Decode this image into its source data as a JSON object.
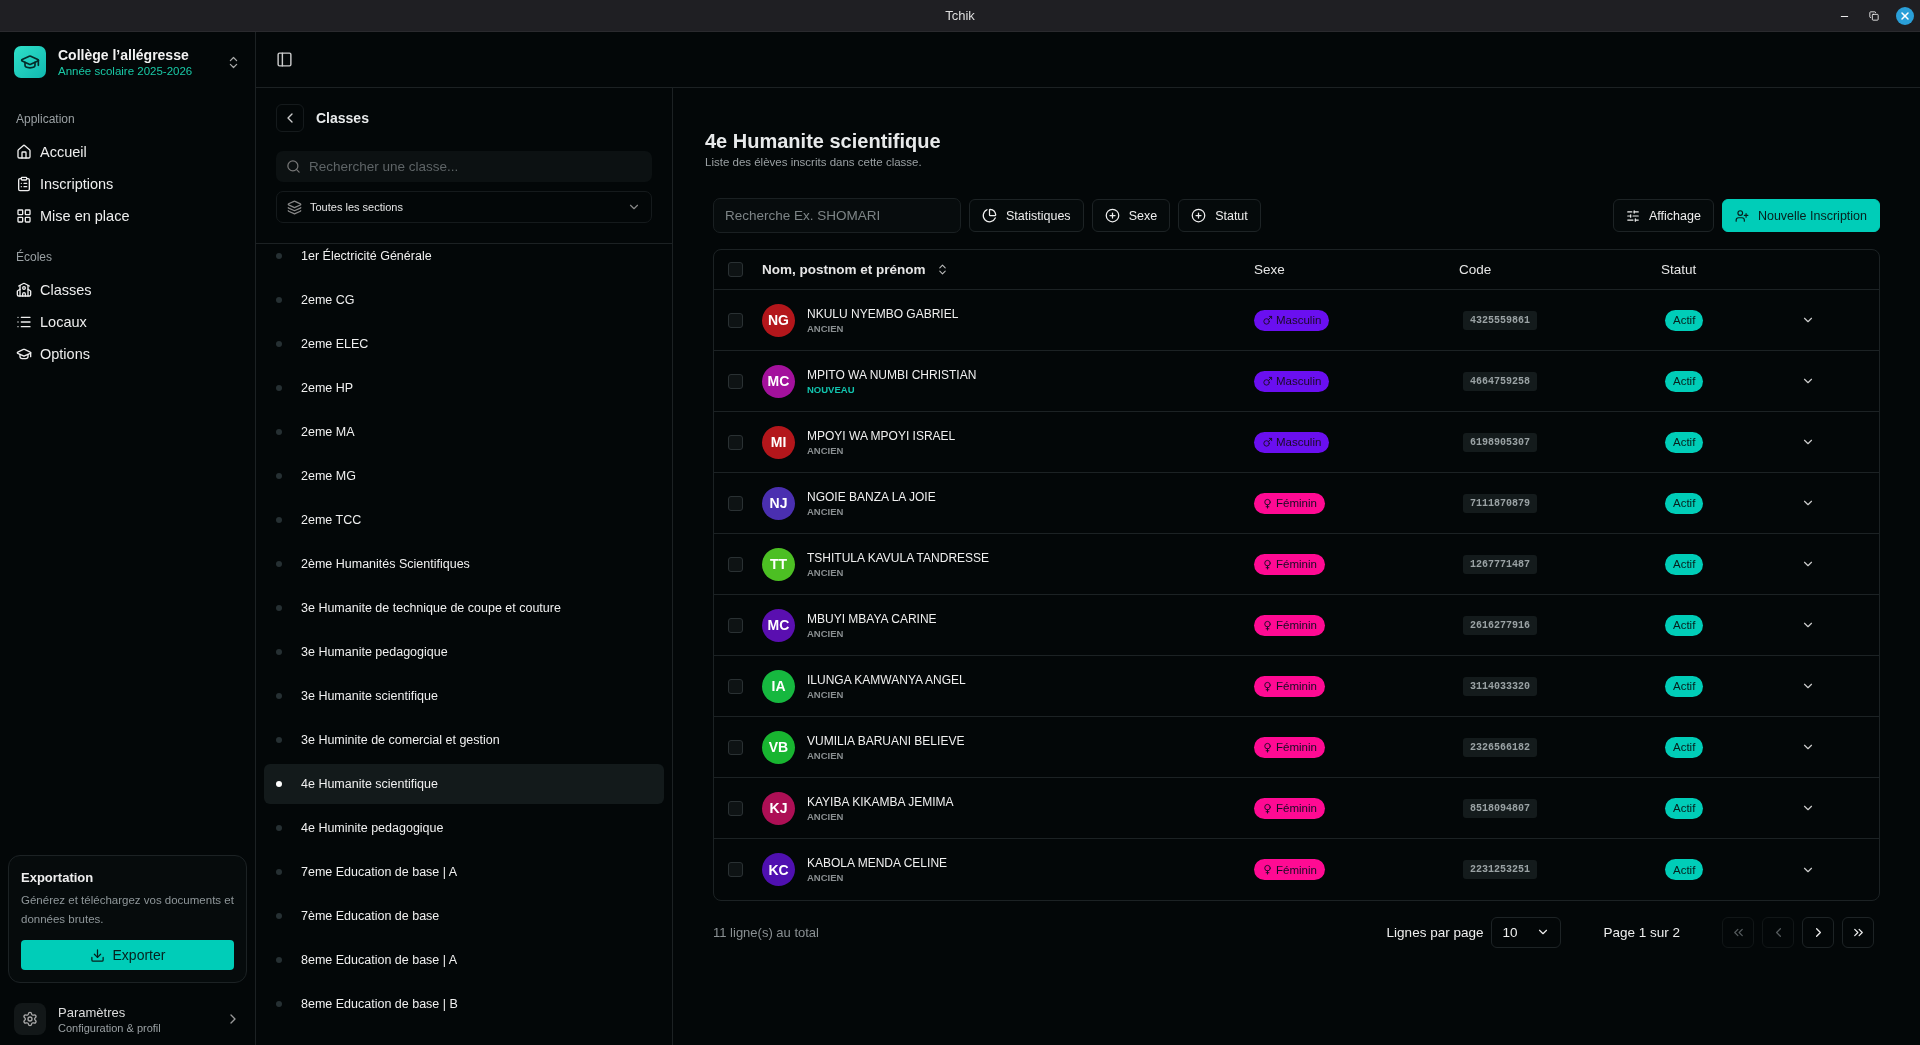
{
  "window": {
    "title": "Tchik"
  },
  "sidebar": {
    "school": {
      "name": "Collège l’allégresse",
      "year": "Année scolaire 2025-2026"
    },
    "groups": [
      {
        "label": "Application",
        "items": [
          {
            "kind": "home",
            "label": "Accueil",
            "selected": false
          },
          {
            "kind": "clipboard",
            "label": "Inscriptions",
            "selected": false
          },
          {
            "kind": "grid",
            "label": "Mise en place",
            "selected": false
          }
        ]
      },
      {
        "label": "Écoles",
        "items": [
          {
            "kind": "school",
            "label": "Classes",
            "selected": false
          },
          {
            "kind": "list",
            "label": "Locaux",
            "selected": false
          },
          {
            "kind": "cap",
            "label": "Options",
            "selected": false
          }
        ]
      }
    ],
    "export_card": {
      "title": "Exportation",
      "text": "Générez et téléchargez vos documents et données brutes.",
      "button": "Exporter"
    },
    "settings": {
      "title": "Paramètres",
      "subtitle": "Configuration & profil"
    }
  },
  "classes_panel": {
    "title": "Classes",
    "search": {
      "placeholder": "Rechercher une classe..."
    },
    "section_filter": "Toutes les sections",
    "items": [
      {
        "label": "1er Électricité Générale",
        "selected": false
      },
      {
        "label": "2eme CG",
        "selected": false
      },
      {
        "label": "2eme ELEC",
        "selected": false
      },
      {
        "label": "2eme HP",
        "selected": false
      },
      {
        "label": "2eme MA",
        "selected": false
      },
      {
        "label": "2eme MG",
        "selected": false
      },
      {
        "label": "2eme TCC",
        "selected": false
      },
      {
        "label": "2ème Humanités Scientifiques",
        "selected": false
      },
      {
        "label": "3e Humanite de technique de coupe et couture",
        "selected": false
      },
      {
        "label": "3e Humanite pedagogique",
        "selected": false
      },
      {
        "label": "3e Humanite scientifique",
        "selected": false
      },
      {
        "label": "3e Huminite de comercial et gestion",
        "selected": false
      },
      {
        "label": "4e Humanite scientifique",
        "selected": true
      },
      {
        "label": "4e Huminite pedagogique",
        "selected": false
      },
      {
        "label": "7eme Education de base | A",
        "selected": false
      },
      {
        "label": "7ème Education de base",
        "selected": false
      },
      {
        "label": "8eme Education de base | A",
        "selected": false
      },
      {
        "label": "8eme Education de base | B",
        "selected": false
      }
    ]
  },
  "main": {
    "title": "4e Humanite scientifique",
    "subtitle": "Liste des élèves inscrits dans cette classe.",
    "toolbar": {
      "search": {
        "placeholder": "Recherche Ex. SHOMARI"
      },
      "filters": [
        {
          "kind": "chart",
          "label": "Statistiques"
        },
        {
          "kind": "add",
          "label": "Sexe"
        },
        {
          "kind": "add",
          "label": "Statut"
        }
      ],
      "view_button": "Affichage",
      "new_button": "Nouvelle Inscription"
    },
    "table": {
      "select_all": {
        "checked": false
      },
      "columns": [
        "Nom, postnom et prénom",
        "Sexe",
        "Code",
        "Statut"
      ],
      "rows": [
        {
          "initials": "NG",
          "color": "#b3161b",
          "name": "NKULU NYEMBO GABRIEL",
          "tag": "ANCIEN",
          "is_new": false,
          "kind": "male",
          "sex": "Masculin",
          "code": "4325559861",
          "status": "Actif",
          "checked": false
        },
        {
          "initials": "MC",
          "color": "#a3119c",
          "name": "MPITO WA NUMBI CHRISTIAN",
          "tag": "NOUVEAU",
          "is_new": true,
          "kind": "male",
          "sex": "Masculin",
          "code": "4664759258",
          "status": "Actif",
          "checked": false
        },
        {
          "initials": "MI",
          "color": "#b3161b",
          "name": "MPOYI WA MPOYI ISRAEL",
          "tag": "ANCIEN",
          "is_new": false,
          "kind": "male",
          "sex": "Masculin",
          "code": "6198905307",
          "status": "Actif",
          "checked": false
        },
        {
          "initials": "NJ",
          "color": "#4a2fb0",
          "name": "NGOIE BANZA LA JOIE",
          "tag": "ANCIEN",
          "is_new": false,
          "kind": "female",
          "sex": "Féminin",
          "code": "7111870879",
          "status": "Actif",
          "checked": false
        },
        {
          "initials": "TT",
          "color": "#4cbf23",
          "name": "TSHITULA KAVULA TANDRESSE",
          "tag": "ANCIEN",
          "is_new": false,
          "kind": "female",
          "sex": "Féminin",
          "code": "1267771487",
          "status": "Actif",
          "checked": false
        },
        {
          "initials": "MC",
          "color": "#5a0fb0",
          "name": "MBUYI MBAYA CARINE",
          "tag": "ANCIEN",
          "is_new": false,
          "kind": "female",
          "sex": "Féminin",
          "code": "2616277916",
          "status": "Actif",
          "checked": false
        },
        {
          "initials": "IA",
          "color": "#16b83f",
          "name": "ILUNGA KAMWANYA ANGEL",
          "tag": "ANCIEN",
          "is_new": false,
          "kind": "female",
          "sex": "Féminin",
          "code": "3114033320",
          "status": "Actif",
          "checked": false
        },
        {
          "initials": "VB",
          "color": "#18b530",
          "name": "VUMILIA BARUANI BELIEVE",
          "tag": "ANCIEN",
          "is_new": false,
          "kind": "female",
          "sex": "Féminin",
          "code": "2326566182",
          "status": "Actif",
          "checked": false
        },
        {
          "initials": "KJ",
          "color": "#ad0f55",
          "name": "KAYIBA KIKAMBA JEMIMA",
          "tag": "ANCIEN",
          "is_new": false,
          "kind": "female",
          "sex": "Féminin",
          "code": "8518094807",
          "status": "Actif",
          "checked": false
        },
        {
          "initials": "KC",
          "color": "#4f10b0",
          "name": "KABOLA MENDA CELINE",
          "tag": "ANCIEN",
          "is_new": false,
          "kind": "female",
          "sex": "Féminin",
          "code": "2231253251",
          "status": "Actif",
          "checked": false
        }
      ]
    },
    "footer": {
      "total": "11 ligne(s) au total",
      "rows_label": "Lignes par page",
      "rows_value": "10",
      "page": "Page 1 sur 2",
      "nav": [
        {
          "kind": "first",
          "disabled": true
        },
        {
          "kind": "prev",
          "disabled": true
        },
        {
          "kind": "next",
          "disabled": false
        },
        {
          "kind": "last",
          "disabled": false
        }
      ]
    }
  }
}
